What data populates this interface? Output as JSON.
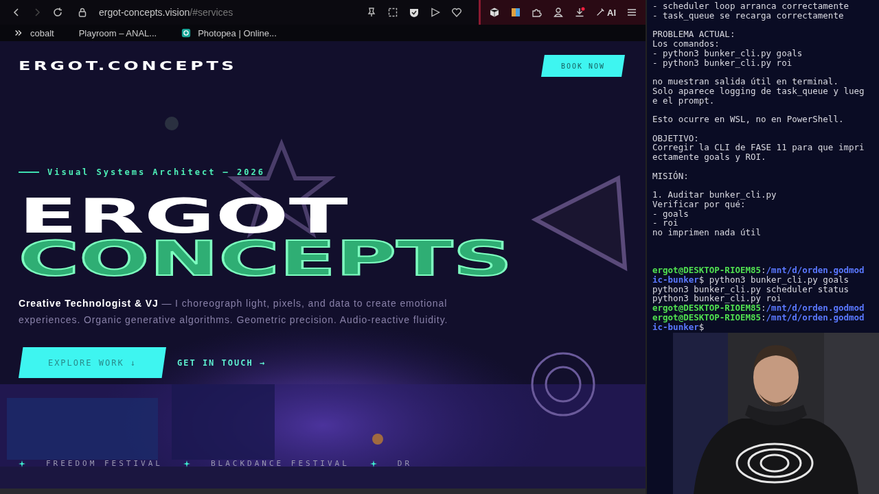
{
  "browser": {
    "address_bar": {
      "domain": "ergot-concepts.vision",
      "path": "/#services"
    },
    "ai_button": "AI",
    "bookmarks": [
      {
        "label": "cobalt",
        "kind": "chevrons"
      },
      {
        "label": "Playroom – ANAL...",
        "kind": "plain"
      },
      {
        "label": "Photopea | Online...",
        "kind": "app"
      }
    ]
  },
  "site": {
    "logo": "ERGOT.CONCEPTS",
    "book_button": "BOOK NOW",
    "tagline": "Visual Systems Architect — 2026",
    "title_line1": "ERGOT",
    "title_line2": "CONCEPTS",
    "intro": "**Creative Technologist & VJ** — I choreograph light, pixels, and data to create emotional experiences. Organic generative algorithms. Geometric precision. Audio-reactive fluidity.",
    "buttons": [
      {
        "label": "EXPLORE WORK ↓",
        "kind": "primary"
      },
      {
        "label": "GET IN TOUCH →",
        "kind": "link"
      }
    ],
    "marquee": [
      "FREEDOM FESTIVAL",
      "BLACKDANCE FESTIVAL",
      "DR"
    ]
  },
  "terminal": {
    "lines": [
      {
        "kind": "text",
        "segments": [
          {
            "kind": "plain",
            "text": "- scheduler loop arranca correctamente"
          }
        ]
      },
      {
        "kind": "text",
        "segments": [
          {
            "kind": "plain",
            "text": "- task_queue se recarga correctamente"
          }
        ]
      },
      {
        "kind": "blank"
      },
      {
        "kind": "text",
        "segments": [
          {
            "kind": "plain",
            "text": "PROBLEMA ACTUAL:"
          }
        ]
      },
      {
        "kind": "text",
        "segments": [
          {
            "kind": "plain",
            "text": "Los comandos:"
          }
        ]
      },
      {
        "kind": "text",
        "segments": [
          {
            "kind": "plain",
            "text": "- python3 bunker_cli.py goals"
          }
        ]
      },
      {
        "kind": "text",
        "segments": [
          {
            "kind": "plain",
            "text": "- python3 bunker_cli.py roi"
          }
        ]
      },
      {
        "kind": "blank"
      },
      {
        "kind": "text",
        "segments": [
          {
            "kind": "plain",
            "text": "no muestran salida útil en terminal."
          }
        ]
      },
      {
        "kind": "text",
        "segments": [
          {
            "kind": "plain",
            "text": "Solo aparece logging de task_queue y lueg"
          }
        ]
      },
      {
        "kind": "text",
        "segments": [
          {
            "kind": "plain",
            "text": "e el prompt."
          }
        ]
      },
      {
        "kind": "blank"
      },
      {
        "kind": "text",
        "segments": [
          {
            "kind": "plain",
            "text": "Esto ocurre en WSL, no en PowerShell."
          }
        ]
      },
      {
        "kind": "blank"
      },
      {
        "kind": "text",
        "segments": [
          {
            "kind": "plain",
            "text": "OBJETIVO:"
          }
        ]
      },
      {
        "kind": "text",
        "segments": [
          {
            "kind": "plain",
            "text": "Corregir la CLI de FASE 11 para que impri"
          }
        ]
      },
      {
        "kind": "text",
        "segments": [
          {
            "kind": "plain",
            "text": "ectamente goals y ROI."
          }
        ]
      },
      {
        "kind": "blank"
      },
      {
        "kind": "text",
        "segments": [
          {
            "kind": "plain",
            "text": "MISIÓN:"
          }
        ]
      },
      {
        "kind": "blank"
      },
      {
        "kind": "text",
        "segments": [
          {
            "kind": "plain",
            "text": "1. Auditar bunker_cli.py"
          }
        ]
      },
      {
        "kind": "text",
        "segments": [
          {
            "kind": "plain",
            "text": "Verificar por qué:"
          }
        ]
      },
      {
        "kind": "text",
        "segments": [
          {
            "kind": "plain",
            "text": "- goals"
          }
        ]
      },
      {
        "kind": "text",
        "segments": [
          {
            "kind": "plain",
            "text": "- roi"
          }
        ]
      },
      {
        "kind": "text",
        "segments": [
          {
            "kind": "plain",
            "text": "no imprimen nada útil"
          }
        ]
      },
      {
        "kind": "blank"
      },
      {
        "kind": "blank"
      },
      {
        "kind": "blank"
      },
      {
        "kind": "text",
        "segments": [
          {
            "kind": "user",
            "text": "ergot@DESKTOP-RIOEM85"
          },
          {
            "kind": "plain",
            "text": ":"
          },
          {
            "kind": "path",
            "text": "/mnt/d/orden.godmod"
          }
        ]
      },
      {
        "kind": "text",
        "segments": [
          {
            "kind": "path",
            "text": "ic-bunker"
          },
          {
            "kind": "plain",
            "text": "$ python3 bunker_cli.py goals"
          }
        ]
      },
      {
        "kind": "text",
        "segments": [
          {
            "kind": "plain",
            "text": "python3 bunker_cli.py scheduler status"
          }
        ]
      },
      {
        "kind": "text",
        "segments": [
          {
            "kind": "plain",
            "text": "python3 bunker_cli.py roi"
          }
        ]
      },
      {
        "kind": "text",
        "segments": [
          {
            "kind": "user",
            "text": "ergot@DESKTOP-RIOEM85"
          },
          {
            "kind": "plain",
            "text": ":"
          },
          {
            "kind": "path",
            "text": "/mnt/d/orden.godmod"
          }
        ]
      },
      {
        "kind": "text",
        "segments": [
          {
            "kind": "user",
            "text": "ergot@DESKTOP-RIOEM85"
          },
          {
            "kind": "plain",
            "text": ":"
          },
          {
            "kind": "path",
            "text": "/mnt/d/orden.godmod"
          }
        ]
      },
      {
        "kind": "text",
        "segments": [
          {
            "kind": "path",
            "text": "ic-bunker"
          },
          {
            "kind": "plain",
            "text": "$"
          }
        ]
      }
    ]
  }
}
